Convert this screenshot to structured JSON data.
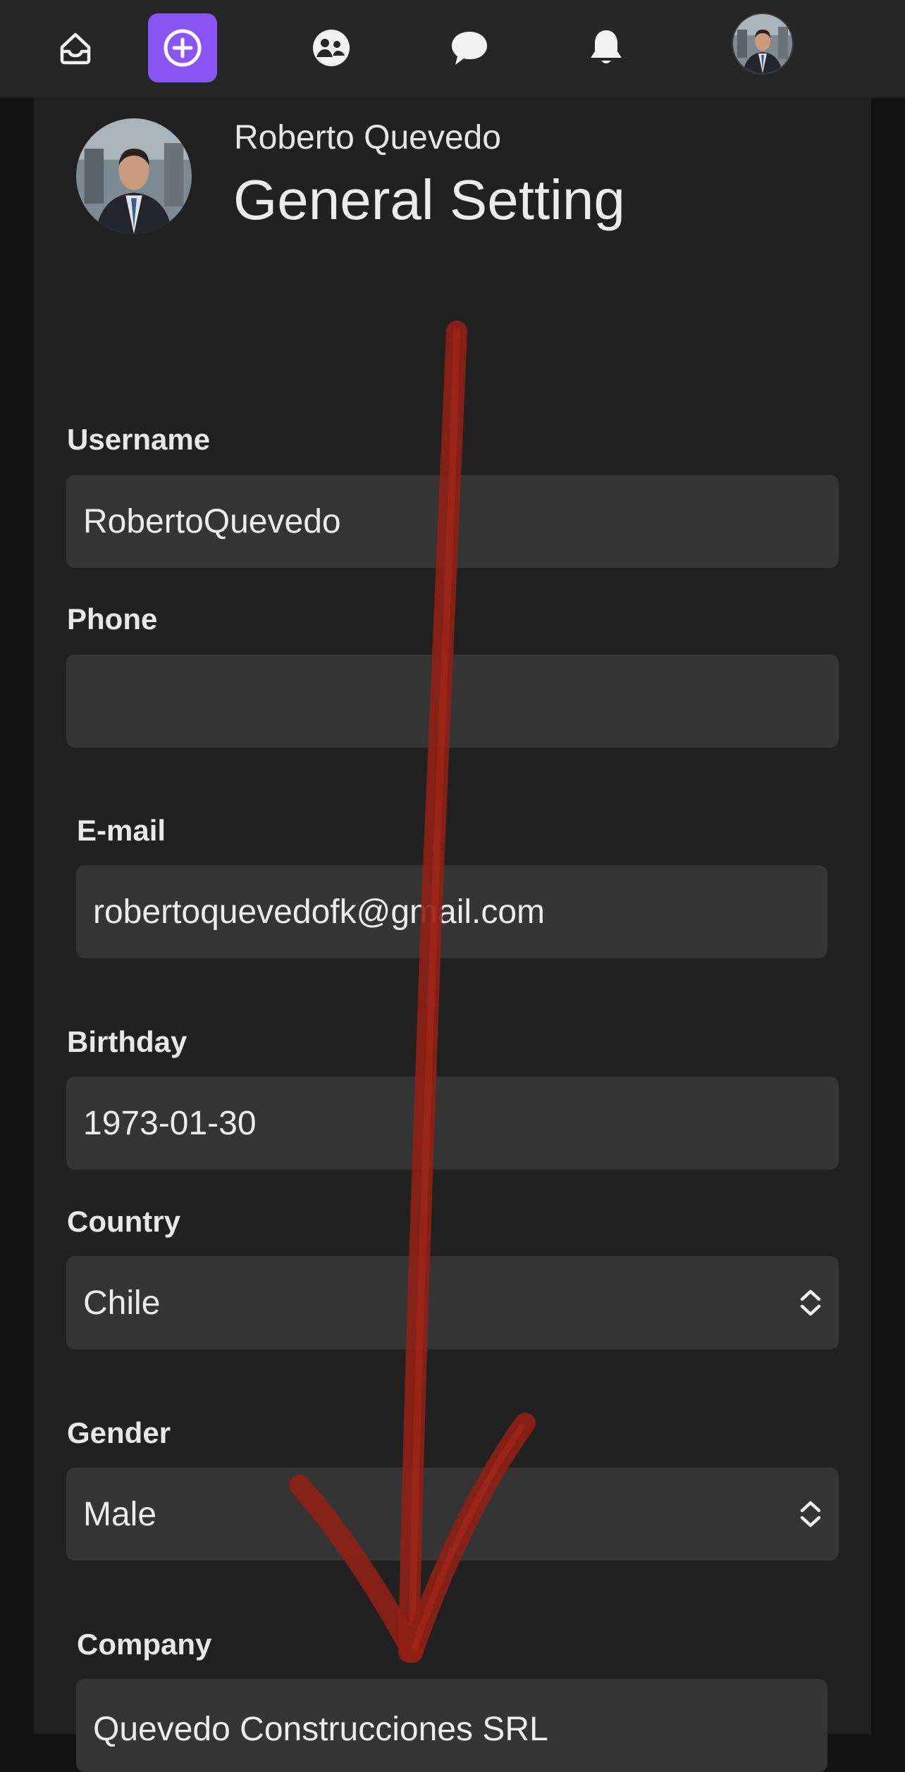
{
  "nav": {
    "items": [
      {
        "name": "home",
        "icon": "inbox-home-icon"
      },
      {
        "name": "create",
        "icon": "plus-circle-icon",
        "active": true
      },
      {
        "name": "community",
        "icon": "people-icon"
      },
      {
        "name": "messages",
        "icon": "chat-bubble-icon"
      },
      {
        "name": "notifications",
        "icon": "bell-icon"
      },
      {
        "name": "profile",
        "icon": "avatar"
      }
    ],
    "accent_color": "#8b54f7"
  },
  "header": {
    "user_name": "Roberto Quevedo",
    "title": "General Setting"
  },
  "form": {
    "username": {
      "label": "Username",
      "value": "RobertoQuevedo"
    },
    "phone": {
      "label": "Phone",
      "value": ""
    },
    "email": {
      "label": "E-mail",
      "value": "robertoquevedofk@gmail.com"
    },
    "birthday": {
      "label": "Birthday",
      "value": "1973-01-30"
    },
    "country": {
      "label": "Country",
      "value": "Chile"
    },
    "gender": {
      "label": "Gender",
      "value": "Male"
    },
    "company": {
      "label": "Company",
      "value": "Quevedo Construcciones SRL"
    }
  },
  "annotation": {
    "type": "hand-drawn arrow pointing down",
    "color": "#9c2215"
  }
}
